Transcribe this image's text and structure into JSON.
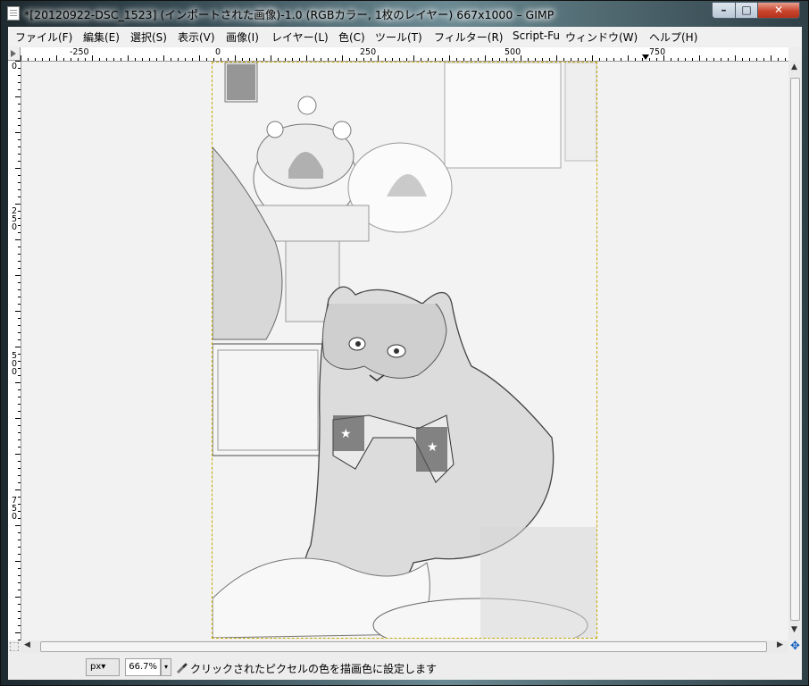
{
  "window": {
    "title": "*[20120922-DSC_1523] (インポートされた画像)-1.0 (RGBカラー, 1枚のレイヤー) 667x1000 – GIMP",
    "min_label": "–",
    "max_label": "□",
    "close_label": "✕"
  },
  "menubar": {
    "items": [
      {
        "label": "ファイル(F)"
      },
      {
        "label": "編集(E)"
      },
      {
        "label": "選択(S)"
      },
      {
        "label": "表示(V)"
      },
      {
        "label": "画像(I)"
      },
      {
        "label": "レイヤー(L)"
      },
      {
        "label": "色(C)"
      },
      {
        "label": "ツール(T)"
      },
      {
        "label": "フィルター(R)"
      },
      {
        "label": "Script-Fu"
      },
      {
        "label": "ウィンドウ(W)"
      },
      {
        "label": "ヘルプ(H)"
      }
    ]
  },
  "rulers": {
    "horizontal_labels": [
      "-250",
      "0",
      "250",
      "500",
      "750"
    ],
    "vertical_labels": [
      "0",
      "250",
      "500",
      "750"
    ]
  },
  "statusbar": {
    "unit": "px▾",
    "zoom": "66.7%",
    "zoom_dropdown": "▾",
    "message": "クリックされたピクセルの色を描画色に設定します"
  },
  "icons": {
    "status_tool": "eyedropper-icon",
    "navigate": "navigate-icon",
    "quick_mask": "quick-mask-icon"
  }
}
